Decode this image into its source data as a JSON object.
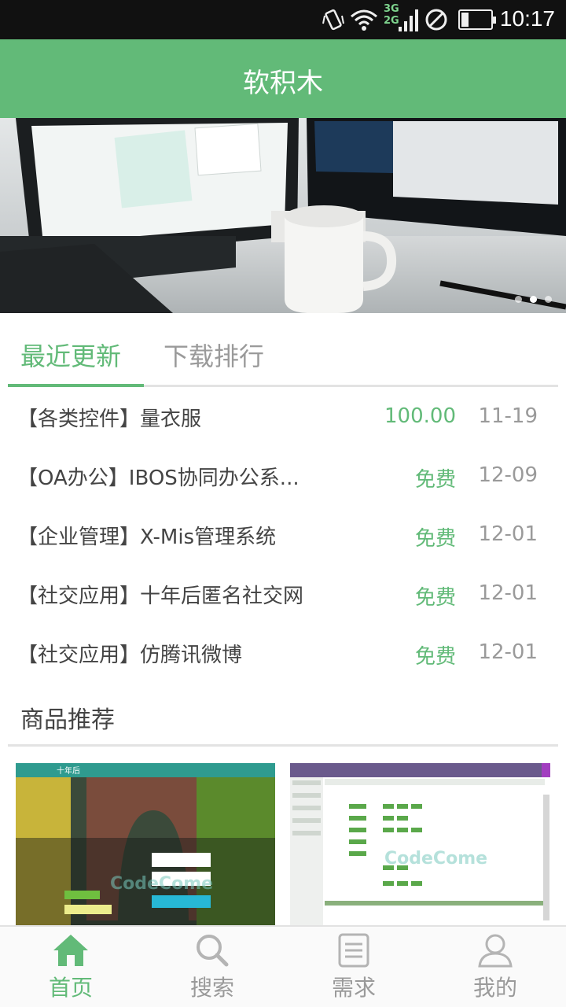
{
  "status_bar": {
    "time": "10:17",
    "network": [
      "3G",
      "2G"
    ]
  },
  "app": {
    "title": "软积木"
  },
  "banner": {
    "image": "desk-monitors-coffee-mug",
    "dot_count": 3,
    "active_dot": 2
  },
  "tabs": [
    {
      "label": "最近更新",
      "active": true
    },
    {
      "label": "下载排行",
      "active": false
    }
  ],
  "recent_list": [
    {
      "name": "【各类控件】量衣服",
      "price": "100.00",
      "date": "11-19"
    },
    {
      "name": "【OA办公】IBOS协同办公系...",
      "price": "免费",
      "date": "12-09"
    },
    {
      "name": "【企业管理】X-Mis管理系统",
      "price": "免费",
      "date": "12-01"
    },
    {
      "name": "【社交应用】十年后匿名社交网",
      "price": "免费",
      "date": "12-01"
    },
    {
      "name": "【社交应用】仿腾讯微博",
      "price": "免费",
      "date": "12-01"
    }
  ],
  "recommend": {
    "title": "商品推荐",
    "cards": [
      {
        "thumbnail": "social-site-screenshot",
        "site_name": "十年后",
        "watermark": "CodeCome"
      },
      {
        "thumbnail": "admin-system-screenshot",
        "watermark": "CodeCome"
      }
    ]
  },
  "bottom_nav": [
    {
      "label": "首页",
      "icon": "home-icon",
      "active": true
    },
    {
      "label": "搜索",
      "icon": "search-icon",
      "active": false
    },
    {
      "label": "需求",
      "icon": "document-icon",
      "active": false
    },
    {
      "label": "我的",
      "icon": "user-icon",
      "active": false
    }
  ],
  "colors": {
    "accent": "#62ba78",
    "status_bar": "#111111",
    "muted_text": "#9a9a9a",
    "body_text": "#444444",
    "divider": "#e3e3e3"
  }
}
